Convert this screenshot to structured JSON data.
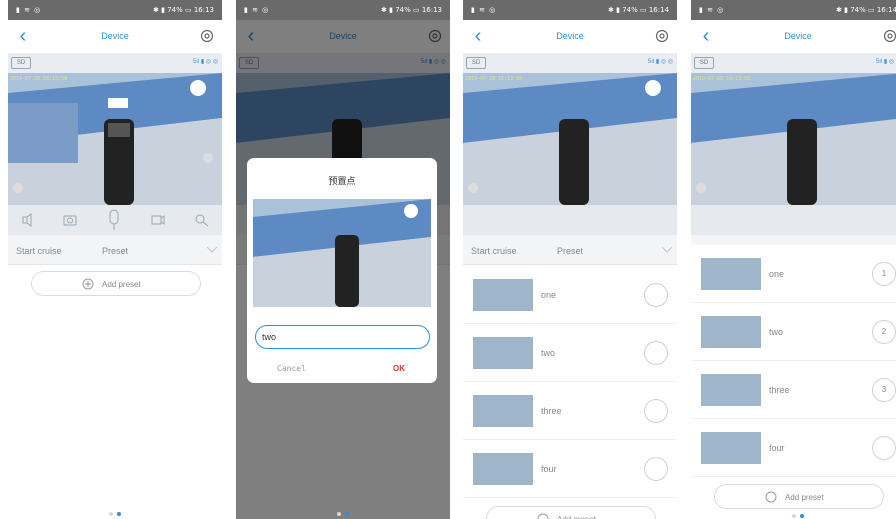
{
  "status_bar": {
    "left": "▮ ≋ ◎",
    "right_1": "✱ ▮ 74% ▭ 16:13",
    "right_2": "✱ ▮ 74% ▭ 16:13",
    "right_3": "✱ ▮ 74% ▭ 16:14",
    "right_4": "✱ ▮ 74% ▭ 16:14"
  },
  "nav": {
    "back": "‹",
    "title": "Device"
  },
  "info": {
    "sd": "SD",
    "signal": "5ıl ▮ ◎ ◎"
  },
  "video": {
    "timestamp": "2019-07-28 16:13:58"
  },
  "tabs": {
    "cruise": "Start cruise",
    "preset": "Preset"
  },
  "add_preset": "Add preset",
  "dialog": {
    "title": "预置点",
    "input_value": "two",
    "cancel": "Cancel",
    "ok": "OK"
  },
  "presets": [
    "one",
    "two",
    "three",
    "four"
  ],
  "preset_numbers": [
    "1",
    "2",
    "3",
    ""
  ],
  "colors": {
    "accent": "#2f8fd8",
    "ok": "#e53935"
  },
  "icons": [
    "back-arrow-icon",
    "gear-icon",
    "sd-icon",
    "mute-icon",
    "camera-icon",
    "mic-icon",
    "record-icon",
    "ptz-icon",
    "chevron-down-icon",
    "add-circle-icon"
  ]
}
